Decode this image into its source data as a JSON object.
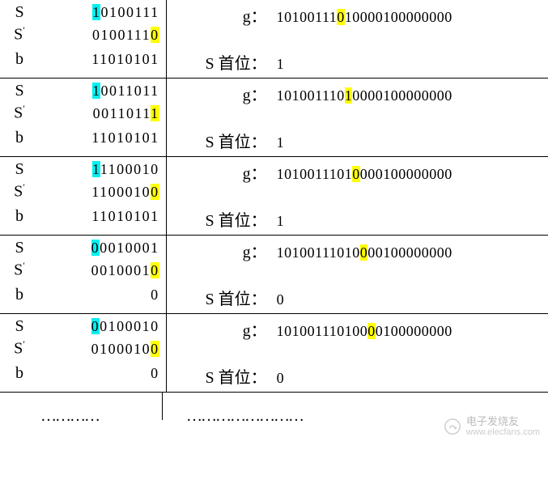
{
  "labels": {
    "S": "S",
    "Sprime": "S′",
    "b": "b",
    "g": "g：",
    "Sfirst": "S 首位：",
    "dots_left": "…………",
    "dots_right": "……………………",
    "wm_line1": "电子发烧友",
    "wm_line2": "www.elecfans.com"
  },
  "rows": [
    {
      "S": {
        "pre": "",
        "hl": "1",
        "hlc": "c",
        "post": "0100111"
      },
      "Sprime": {
        "pre": "0100111",
        "hl": "0",
        "hlc": "y",
        "post": ""
      },
      "b": "11010101",
      "g": {
        "pre": "10100111",
        "hl": "0",
        "hlc": "y",
        "post": "10000100000000"
      },
      "sfirst": "1"
    },
    {
      "S": {
        "pre": "",
        "hl": "1",
        "hlc": "c",
        "post": "0011011"
      },
      "Sprime": {
        "pre": "0011011",
        "hl": "1",
        "hlc": "y",
        "post": ""
      },
      "b": "11010101",
      "g": {
        "pre": "101001110",
        "hl": "1",
        "hlc": "y",
        "post": "0000100000000"
      },
      "sfirst": "1"
    },
    {
      "S": {
        "pre": "",
        "hl": "1",
        "hlc": "c",
        "post": "1100010"
      },
      "Sprime": {
        "pre": "1100010",
        "hl": "0",
        "hlc": "y",
        "post": ""
      },
      "b": "11010101",
      "g": {
        "pre": "1010011101",
        "hl": "0",
        "hlc": "y",
        "post": "000100000000"
      },
      "sfirst": "1"
    },
    {
      "S": {
        "pre": "",
        "hl": "0",
        "hlc": "c",
        "post": "0010001"
      },
      "Sprime": {
        "pre": "0010001",
        "hl": "0",
        "hlc": "y",
        "post": ""
      },
      "b": "0",
      "g": {
        "pre": "10100111010",
        "hl": "0",
        "hlc": "y",
        "post": "00100000000"
      },
      "sfirst": "0"
    },
    {
      "S": {
        "pre": "",
        "hl": "0",
        "hlc": "c",
        "post": "0100010"
      },
      "Sprime": {
        "pre": "0100010",
        "hl": "0",
        "hlc": "y",
        "post": ""
      },
      "b": "0",
      "g": {
        "pre": "101001110100",
        "hl": "0",
        "hlc": "y",
        "post": "0100000000"
      },
      "sfirst": "0"
    }
  ]
}
